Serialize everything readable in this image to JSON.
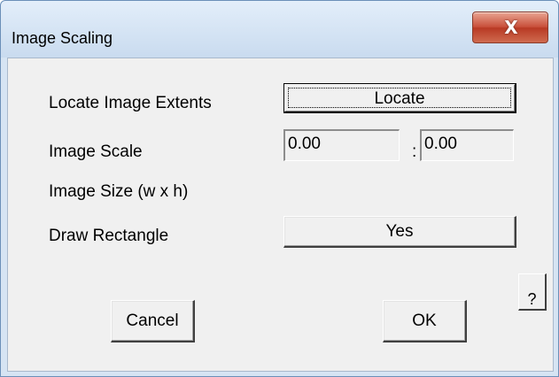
{
  "window": {
    "title": "Image Scaling",
    "close_glyph": "X"
  },
  "rows": {
    "locate_label": "Locate Image Extents",
    "locate_button": "Locate",
    "scale_label": "Image Scale",
    "scale_left_value": "0.00",
    "scale_separator": ":",
    "scale_right_value": "0.00",
    "size_label": "Image Size (w x h)",
    "draw_label": "Draw Rectangle",
    "draw_button": "Yes"
  },
  "footer": {
    "cancel_label": "Cancel",
    "ok_label": "OK",
    "help_label": "?"
  },
  "colors": {
    "close_button": "#c9503b",
    "dialog_face": "#f0f0f0",
    "frame": "#d6e4f3"
  },
  "icons": {
    "close": "close-icon"
  }
}
